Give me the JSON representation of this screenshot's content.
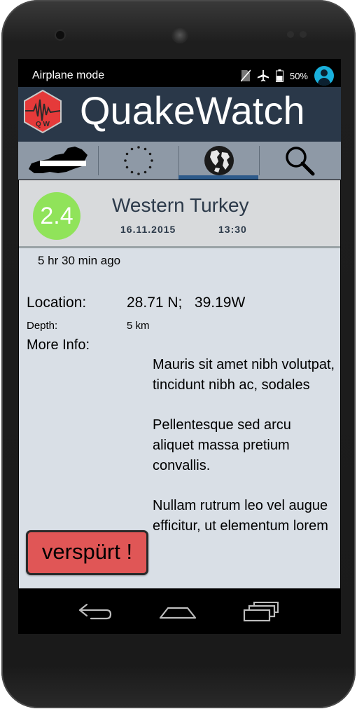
{
  "status_bar": {
    "mode": "Airplane mode",
    "battery": "50%"
  },
  "app": {
    "title": "QuakeWatch",
    "logo_text": "Q W"
  },
  "tabs": [
    {
      "id": "austria",
      "icon": "austria-map-icon"
    },
    {
      "id": "europe",
      "icon": "eu-stars-icon"
    },
    {
      "id": "world",
      "icon": "globe-icon",
      "selected": true
    },
    {
      "id": "search",
      "icon": "search-icon"
    }
  ],
  "quake": {
    "magnitude": "2.4",
    "place": "Western Turkey",
    "date": "16.11.2015",
    "time": "13:30",
    "ago": "5 hr 30 min ago",
    "location_label": "Location:",
    "location_value": "28.71 N;   39.19W",
    "depth_label": "Depth:",
    "depth_value": "5 km",
    "more_label": "More Info:",
    "more_paragraphs": [
      "Mauris sit amet nibh volutpat, tincidunt nibh ac, sodales",
      "Pellentesque sed arcu aliquet massa pretium convallis.",
      "Nullam rutrum leo vel augue efficitur, ut elementum lorem"
    ],
    "felt_button": "verspürt !"
  },
  "colors": {
    "appbar": "#2a3849",
    "tabs": "#8e99a6",
    "magnitude": "#90e35a",
    "felt_button": "#e05656",
    "content": "#d9dfe6"
  }
}
